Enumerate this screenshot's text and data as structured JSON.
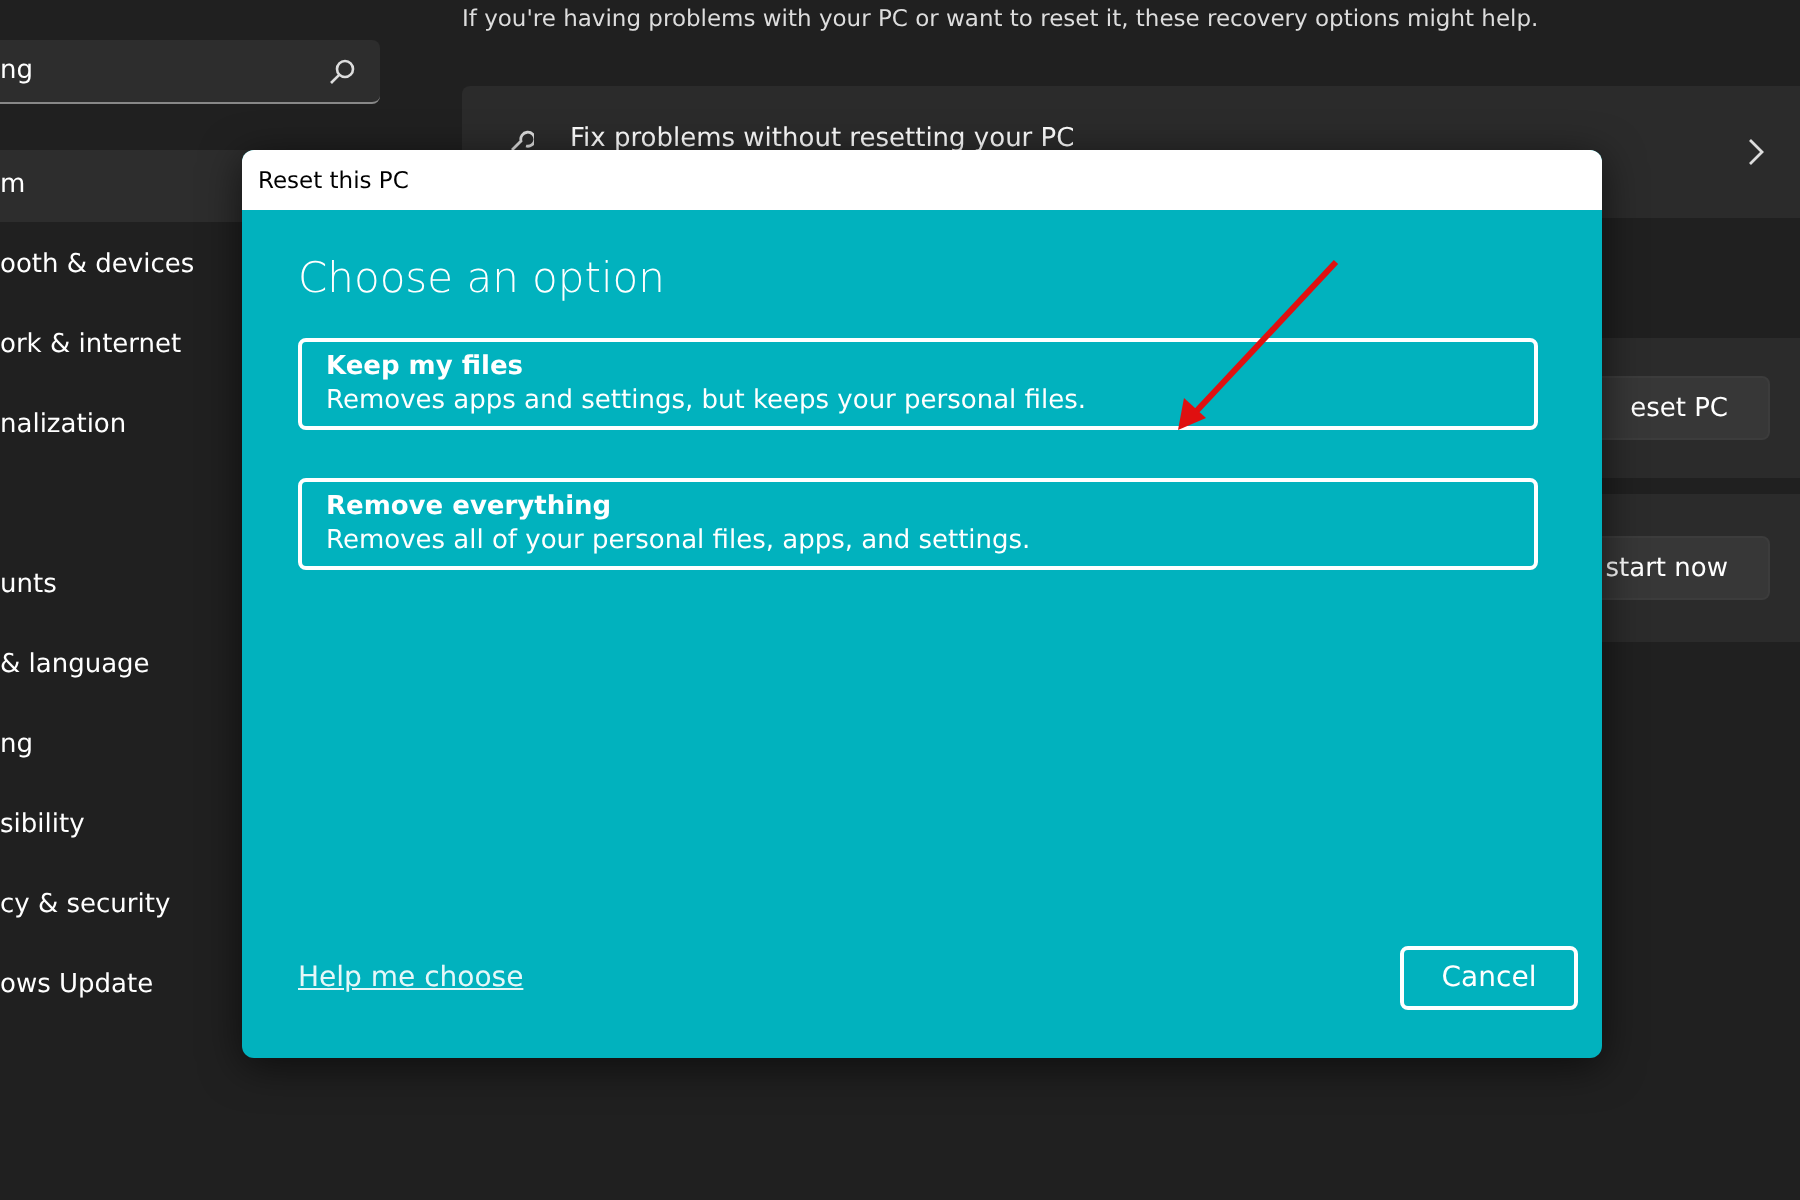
{
  "search": {
    "value": "ng"
  },
  "sidebar": {
    "items": [
      {
        "label": "m",
        "selected": true
      },
      {
        "label": "ooth & devices",
        "selected": false
      },
      {
        "label": "ork & internet",
        "selected": false
      },
      {
        "label": "nalization",
        "selected": false
      },
      {
        "label": "unts",
        "selected": false
      },
      {
        "label": "& language",
        "selected": false
      },
      {
        "label": "ng",
        "selected": false
      },
      {
        "label": "sibility",
        "selected": false
      },
      {
        "label": "cy & security",
        "selected": false
      },
      {
        "label": "ows Update",
        "selected": false
      }
    ]
  },
  "content": {
    "intro": "If you're having problems with your PC or want to reset it, these recovery options might help.",
    "fix_card": {
      "title": "Fix problems without resetting your PC"
    },
    "reset_card": {
      "button": "eset PC"
    },
    "advanced_card": {
      "button": "start now"
    }
  },
  "dialog": {
    "title": "Reset this PC",
    "heading": "Choose an option",
    "options": [
      {
        "title": "Keep my files",
        "description": "Removes apps and settings, but keeps your personal files."
      },
      {
        "title": "Remove everything",
        "description": "Removes all of your personal files, apps, and settings."
      }
    ],
    "help_link": "Help me choose",
    "cancel": "Cancel"
  }
}
